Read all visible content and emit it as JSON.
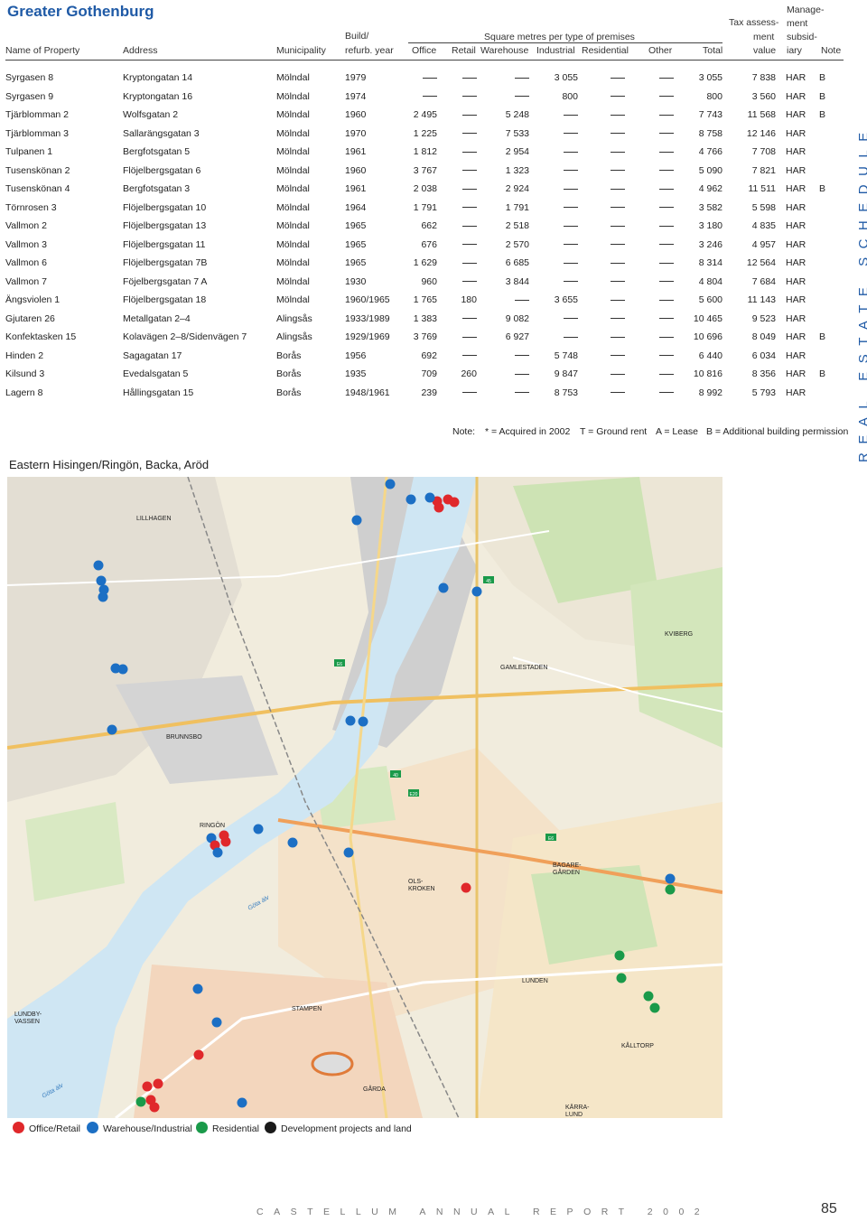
{
  "region_title": "Greater Gothenburg",
  "headers": {
    "name": "Name of Property",
    "address": "Address",
    "municipality": "Municipality",
    "build_top": "Build/",
    "build_bottom": "refurb. year",
    "sqm_group": "Square metres per type of premises",
    "office": "Office",
    "retail": "Retail",
    "warehouse": "Warehouse",
    "industrial": "Industrial",
    "residential": "Residential",
    "other": "Other",
    "total": "Total",
    "tax_1": "Tax assess-",
    "tax_2": "ment",
    "tax_3": "value",
    "mgmt_1": "Manage-",
    "mgmt_2": "ment",
    "mgmt_3": "subsid-",
    "mgmt_4": "iary",
    "note": "Note"
  },
  "rows": [
    {
      "name": "Syrgasen 8",
      "address": "Kryptongatan 14",
      "municipality": "Mölndal",
      "year": "1979",
      "office": "—",
      "retail": "—",
      "warehouse": "—",
      "industrial": "3 055",
      "residential": "—",
      "other": "—",
      "total": "3 055",
      "tax": "7 838",
      "mgmt": "HAR",
      "note": "B"
    },
    {
      "name": "Syrgasen 9",
      "address": "Kryptongatan 16",
      "municipality": "Mölndal",
      "year": "1974",
      "office": "—",
      "retail": "—",
      "warehouse": "—",
      "industrial": "800",
      "residential": "—",
      "other": "—",
      "total": "800",
      "tax": "3 560",
      "mgmt": "HAR",
      "note": "B"
    },
    {
      "name": "Tjärblomman 2",
      "address": "Wolfsgatan 2",
      "municipality": "Mölndal",
      "year": "1960",
      "office": "2 495",
      "retail": "—",
      "warehouse": "5 248",
      "industrial": "—",
      "residential": "—",
      "other": "—",
      "total": "7 743",
      "tax": "11 568",
      "mgmt": "HAR",
      "note": "B"
    },
    {
      "name": "Tjärblomman 3",
      "address": "Sallarängsgatan 3",
      "municipality": "Mölndal",
      "year": "1970",
      "office": "1 225",
      "retail": "—",
      "warehouse": "7 533",
      "industrial": "—",
      "residential": "—",
      "other": "—",
      "total": "8 758",
      "tax": "12 146",
      "mgmt": "HAR",
      "note": ""
    },
    {
      "name": "Tulpanen 1",
      "address": "Bergfotsgatan 5",
      "municipality": "Mölndal",
      "year": "1961",
      "office": "1 812",
      "retail": "—",
      "warehouse": "2 954",
      "industrial": "—",
      "residential": "—",
      "other": "—",
      "total": "4 766",
      "tax": "7 708",
      "mgmt": "HAR",
      "note": ""
    },
    {
      "name": "Tusenskönan 2",
      "address": "Flöjelbergsgatan 6",
      "municipality": "Mölndal",
      "year": "1960",
      "office": "3 767",
      "retail": "—",
      "warehouse": "1 323",
      "industrial": "—",
      "residential": "—",
      "other": "—",
      "total": "5 090",
      "tax": "7 821",
      "mgmt": "HAR",
      "note": ""
    },
    {
      "name": "Tusenskönan 4",
      "address": "Bergfotsgatan 3",
      "municipality": "Mölndal",
      "year": "1961",
      "office": "2 038",
      "retail": "—",
      "warehouse": "2 924",
      "industrial": "—",
      "residential": "—",
      "other": "—",
      "total": "4 962",
      "tax": "11 511",
      "mgmt": "HAR",
      "note": "B"
    },
    {
      "name": "Törnrosen 3",
      "address": "Flöjelbergsgatan 10",
      "municipality": "Mölndal",
      "year": "1964",
      "office": "1 791",
      "retail": "—",
      "warehouse": "1 791",
      "industrial": "—",
      "residential": "—",
      "other": "—",
      "total": "3 582",
      "tax": "5 598",
      "mgmt": "HAR",
      "note": ""
    },
    {
      "name": "Vallmon 2",
      "address": "Flöjelbergsgatan 13",
      "municipality": "Mölndal",
      "year": "1965",
      "office": "662",
      "retail": "—",
      "warehouse": "2 518",
      "industrial": "—",
      "residential": "—",
      "other": "—",
      "total": "3 180",
      "tax": "4 835",
      "mgmt": "HAR",
      "note": ""
    },
    {
      "name": "Vallmon 3",
      "address": "Flöjelbergsgatan 11",
      "municipality": "Mölndal",
      "year": "1965",
      "office": "676",
      "retail": "—",
      "warehouse": "2 570",
      "industrial": "—",
      "residential": "—",
      "other": "—",
      "total": "3 246",
      "tax": "4 957",
      "mgmt": "HAR",
      "note": ""
    },
    {
      "name": "Vallmon 6",
      "address": "Flöjelbergsgatan 7B",
      "municipality": "Mölndal",
      "year": "1965",
      "office": "1 629",
      "retail": "—",
      "warehouse": "6 685",
      "industrial": "—",
      "residential": "—",
      "other": "—",
      "total": "8 314",
      "tax": "12 564",
      "mgmt": "HAR",
      "note": ""
    },
    {
      "name": "Vallmon 7",
      "address": "Föjelbergsgatan 7 A",
      "municipality": "Mölndal",
      "year": "1930",
      "office": "960",
      "retail": "—",
      "warehouse": "3 844",
      "industrial": "—",
      "residential": "—",
      "other": "—",
      "total": "4 804",
      "tax": "7 684",
      "mgmt": "HAR",
      "note": ""
    },
    {
      "name": "Ängsviolen 1",
      "address": "Flöjelbergsgatan 18",
      "municipality": "Mölndal",
      "year": "1960/1965",
      "office": "1 765",
      "retail": "180",
      "warehouse": "—",
      "industrial": "3 655",
      "residential": "—",
      "other": "—",
      "total": "5 600",
      "tax": "11 143",
      "mgmt": "HAR",
      "note": ""
    },
    {
      "name": "Gjutaren 26",
      "address": "Metallgatan 2–4",
      "municipality": "Alingsås",
      "year": "1933/1989",
      "office": "1 383",
      "retail": "—",
      "warehouse": "9 082",
      "industrial": "—",
      "residential": "—",
      "other": "—",
      "total": "10 465",
      "tax": "9 523",
      "mgmt": "HAR",
      "note": ""
    },
    {
      "name": "Konfektasken 15",
      "address": "Kolavägen 2–8/Sidenvägen 7",
      "municipality": "Alingsås",
      "year": "1929/1969",
      "office": "3 769",
      "retail": "—",
      "warehouse": "6 927",
      "industrial": "—",
      "residential": "—",
      "other": "—",
      "total": "10 696",
      "tax": "8 049",
      "mgmt": "HAR",
      "note": "B"
    },
    {
      "name": "Hinden 2",
      "address": "Sagagatan 17",
      "municipality": "Borås",
      "year": "1956",
      "office": "692",
      "retail": "—",
      "warehouse": "—",
      "industrial": "5 748",
      "residential": "—",
      "other": "—",
      "total": "6 440",
      "tax": "6 034",
      "mgmt": "HAR",
      "note": ""
    },
    {
      "name": "Kilsund 3",
      "address": "Evedalsgatan 5",
      "municipality": "Borås",
      "year": "1935",
      "office": "709",
      "retail": "260",
      "warehouse": "—",
      "industrial": "9 847",
      "residential": "—",
      "other": "—",
      "total": "10 816",
      "tax": "8 356",
      "mgmt": "HAR",
      "note": "B"
    },
    {
      "name": "Lagern 8",
      "address": "Hållingsgatan 15",
      "municipality": "Borås",
      "year": "1948/1961",
      "office": "239",
      "retail": "—",
      "warehouse": "—",
      "industrial": "8 753",
      "residential": "—",
      "other": "—",
      "total": "8 992",
      "tax": "5 793",
      "mgmt": "HAR",
      "note": ""
    }
  ],
  "note_line": {
    "label": "Note:",
    "acquired": "* = Acquired in 2002",
    "ground_rent": "T = Ground rent",
    "lease": "A = Lease",
    "building": "B = Additional building permission"
  },
  "side_label": "REAL ESTATE SCHEDULE",
  "map": {
    "title": "Eastern Hisingen/Ringön, Backa, Aröd",
    "place_labels": [
      "LILLHAGEN",
      "KVIBERG",
      "GAMLESTADEN",
      "BRUNNSBO",
      "RINGÖN",
      "BAGARE-\nGÅRDEN",
      "OLS-\nKROKEN",
      "Göta älv",
      "LUNDEN",
      "LUNDBY-\nVASSEN",
      "STAMPEN",
      "KÅLLTORP",
      "GÅRDA",
      "KÄRRA-\nLUND",
      "Göta älv"
    ],
    "road_signs": [
      "45",
      "E6",
      "E20",
      "E6",
      "40"
    ],
    "colors": {
      "office": "#e0282b",
      "warehouse": "#1c6fc4",
      "residential": "#1a9a4a",
      "dev": "#1a1a1a",
      "water": "#cfe6f3"
    }
  },
  "legend": {
    "office": "Office/Retail",
    "warehouse": "Warehouse/Industrial",
    "residential": "Residential",
    "dev": "Development projects and land"
  },
  "footer": "CASTELLUM ANNUAL REPORT 2002",
  "page_number": "85"
}
